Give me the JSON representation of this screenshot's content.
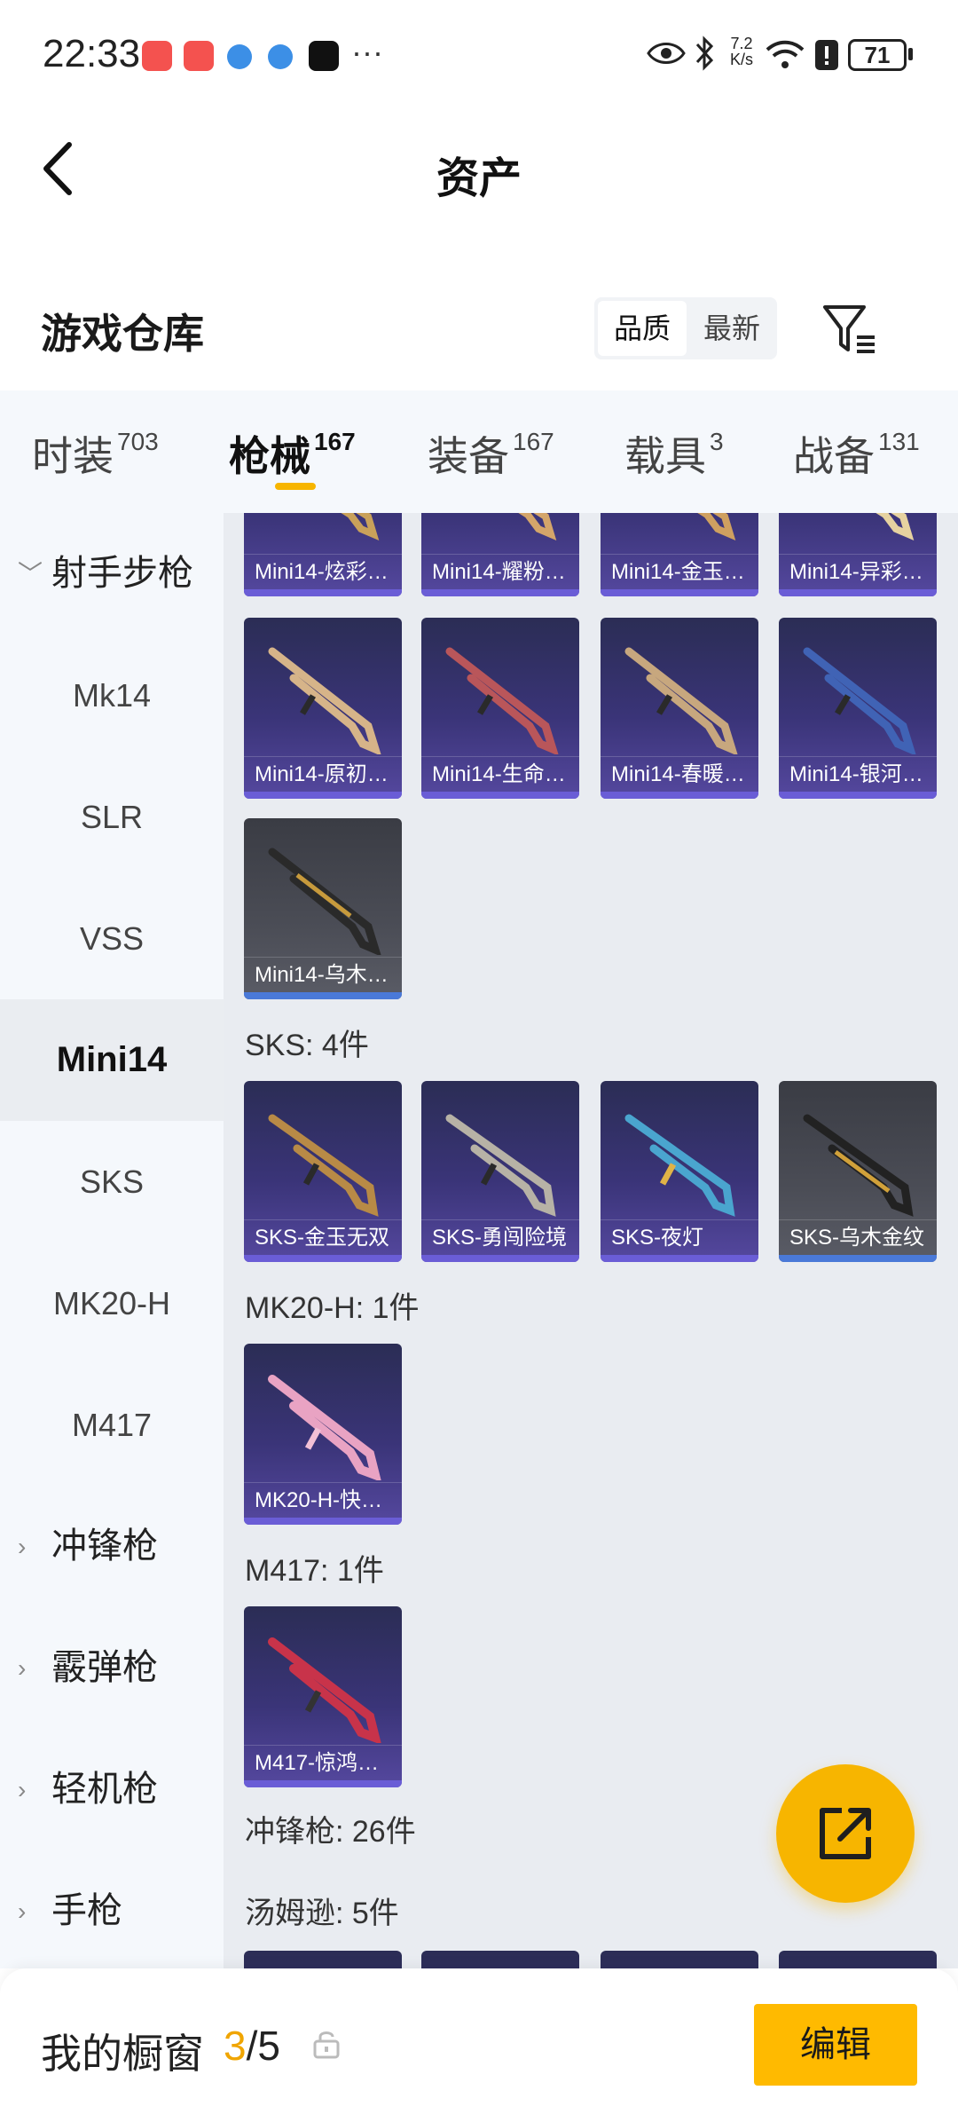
{
  "status_bar": {
    "time": "22:33",
    "speed": "7.2",
    "speed_unit": "K/s",
    "battery": "71",
    "more": "···"
  },
  "app_bar": {
    "title": "资产"
  },
  "warehouse": {
    "title": "游戏仓库",
    "sort_quality": "品质",
    "sort_newest": "最新"
  },
  "tabs": [
    {
      "label": "时装",
      "count": "703"
    },
    {
      "label": "枪械",
      "count": "167"
    },
    {
      "label": "装备",
      "count": "167"
    },
    {
      "label": "载具",
      "count": "3"
    },
    {
      "label": "战备",
      "count": "131"
    }
  ],
  "sidebar": {
    "category_marksman": "射手步枪",
    "items": [
      "Mk14",
      "SLR",
      "VSS",
      "Mini14",
      "SKS",
      "MK20-H",
      "M417"
    ],
    "cat_smg": "冲锋枪",
    "cat_shotgun": "霰弹枪",
    "cat_lmg": "轻机枪",
    "cat_pistol": "手枪"
  },
  "content": {
    "mini14_row1": [
      "Mini14-炫彩…",
      "Mini14-耀粉…",
      "Mini14-金玉…",
      "Mini14-异彩…"
    ],
    "mini14_row2": [
      "Mini14-原初…",
      "Mini14-生命…",
      "Mini14-春暖…",
      "Mini14-银河…"
    ],
    "mini14_row3": [
      "Mini14-乌木…"
    ],
    "sks_header": "SKS: 4件",
    "sks_items": [
      "SKS-金玉无双",
      "SKS-勇闯险境",
      "SKS-夜灯",
      "SKS-乌木金纹"
    ],
    "mk20_header": "MK20-H: 1件",
    "mk20_items": [
      "MK20-H-快…"
    ],
    "m417_header": "M417: 1件",
    "m417_items": [
      "M417-惊鸿…"
    ],
    "smg_header": "冲锋枪: 26件",
    "thompson_header": "汤姆逊: 5件"
  },
  "bottom_bar": {
    "title": "我的橱窗",
    "current": "3",
    "separator": "/",
    "total": "5",
    "edit_label": "编辑"
  },
  "colors": {
    "accent": "#f7b500",
    "card_purple": "#3a3478",
    "card_gray": "#4b4d56"
  }
}
